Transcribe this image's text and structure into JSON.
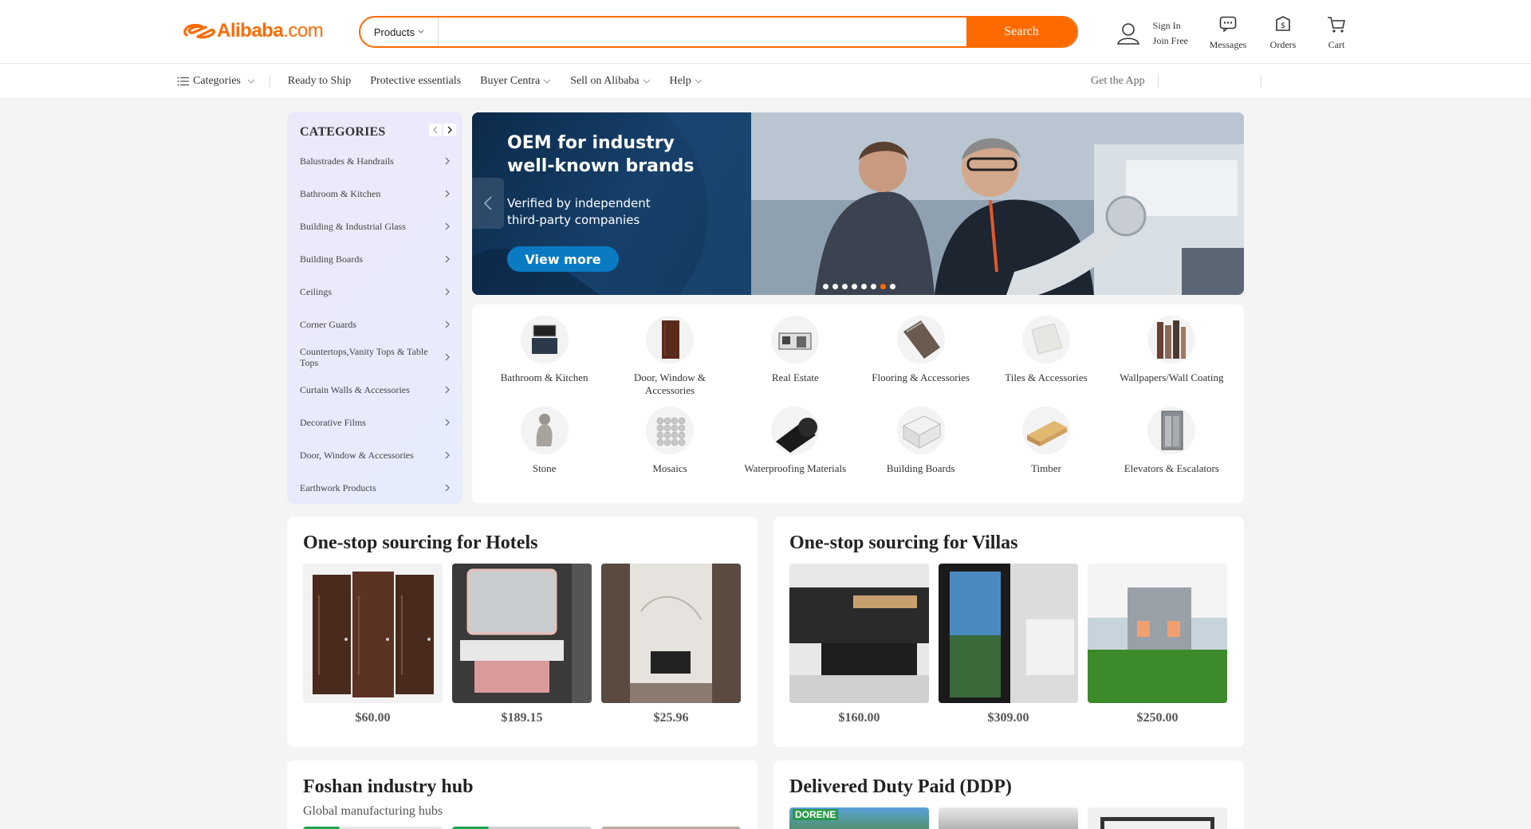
{
  "header": {
    "logo_text": "Alibaba",
    "logo_suffix": ".com",
    "search_type": "Products",
    "search_placeholder": "",
    "search_button": "Search",
    "sign_in": "Sign In",
    "join_free": "Join Free",
    "messages": "Messages",
    "orders": "Orders",
    "cart": "Cart"
  },
  "nav": {
    "categories": "Categories",
    "items": [
      "Ready to Ship",
      "Protective essentials",
      "Buyer Centra",
      "Sell on Alibaba",
      "Help"
    ],
    "get_app": "Get the App"
  },
  "sidebar": {
    "title": "CATEGORIES",
    "items": [
      "Balustrades & Handrails",
      "Bathroom & Kitchen",
      "Building & Industrial Glass",
      "Building Boards",
      "Ceilings",
      "Corner Guards",
      "Countertops,Vanity Tops & Table Tops",
      "Curtain Walls & Accessories",
      "Decorative Films",
      "Door, Window & Accessories",
      "Earthwork Products"
    ]
  },
  "banner": {
    "headline_1": "OEM for industry",
    "headline_2": "well-known brands",
    "sub_1": "Verified by independent",
    "sub_2": "third-party companies",
    "button": "View more",
    "active_dot": 6,
    "dot_count": 8
  },
  "category_grid": [
    {
      "label": "Bathroom & Kitchen",
      "icon": "vanity-icon"
    },
    {
      "label": "Door, Window & Accessories",
      "icon": "door-icon"
    },
    {
      "label": "Real Estate",
      "icon": "house-icon"
    },
    {
      "label": "Flooring & Accessories",
      "icon": "flooring-icon"
    },
    {
      "label": "Tiles & Accessories",
      "icon": "tile-icon"
    },
    {
      "label": "Wallpapers/Wall Coating",
      "icon": "wallpaper-icon"
    },
    {
      "label": "Stone",
      "icon": "statue-icon"
    },
    {
      "label": "Mosaics",
      "icon": "mosaic-icon"
    },
    {
      "label": "Waterproofing Materials",
      "icon": "roll-icon"
    },
    {
      "label": "Building Boards",
      "icon": "board-icon"
    },
    {
      "label": "Timber",
      "icon": "timber-icon"
    },
    {
      "label": "Elevators & Escalators",
      "icon": "elevator-icon"
    }
  ],
  "cards": {
    "hotels": {
      "title": "One-stop sourcing for Hotels",
      "products": [
        {
          "price": "$60.00"
        },
        {
          "price": "$189.15"
        },
        {
          "price": "$25.96"
        }
      ]
    },
    "villas": {
      "title": "One-stop sourcing for Villas",
      "products": [
        {
          "price": "$160.00"
        },
        {
          "price": "$309.00"
        },
        {
          "price": "$250.00"
        }
      ]
    },
    "foshan": {
      "title": "Foshan industry hub",
      "subtitle": "Global manufacturing hubs"
    },
    "ddp": {
      "title": "Delivered Duty Paid (DDP)",
      "badge": "DORENE"
    }
  },
  "colors": {
    "brand": "#ff6a00",
    "banner_button": "#0a7bc2"
  }
}
